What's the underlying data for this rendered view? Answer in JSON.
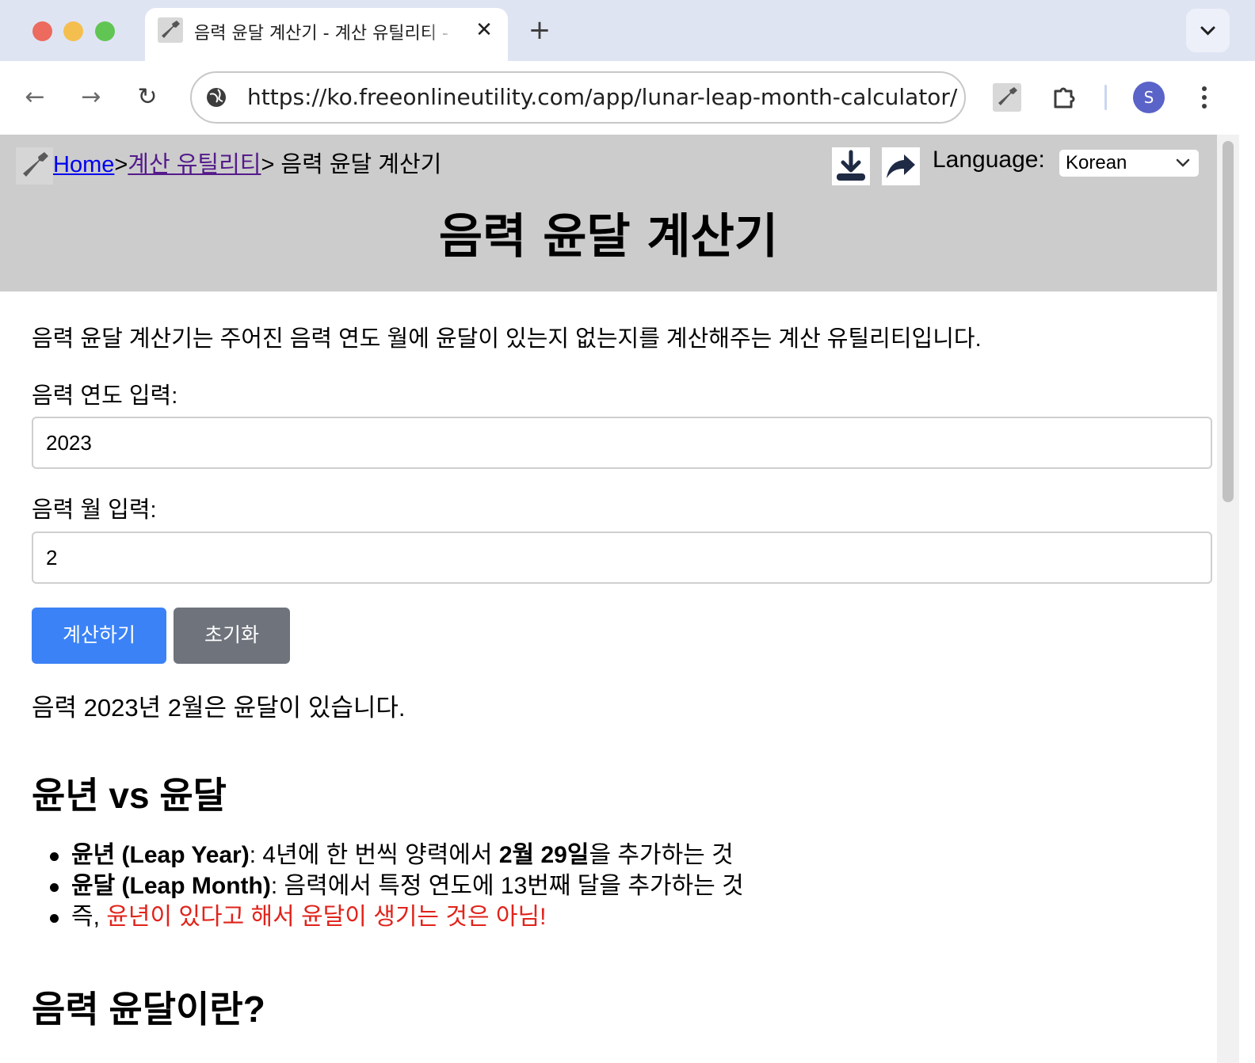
{
  "browser": {
    "tab_title": "음력 윤달 계산기 - 계산 유틸리티 - FreeOnlineUtility",
    "tab_close": "✕",
    "new_tab": "+",
    "url": "https://ko.freeonlineutility.com/app/lunar-leap-month-calculator/",
    "back": "←",
    "forward": "→",
    "reload": "↻",
    "profile_initial": "S"
  },
  "header": {
    "breadcrumb": {
      "home": "Home",
      "sep1": ">",
      "category": "계산 유틸리티",
      "sep2": ">",
      "current": " 음력 윤달 계산기"
    },
    "language_label": "Language:",
    "language_selected": "Korean",
    "title": "음력 윤달 계산기"
  },
  "main": {
    "intro": "음력 윤달 계산기는 주어진 음력 연도 월에 윤달이 있는지 없는지를 계산해주는 계산 유틸리티입니다.",
    "year_label": "음력 연도 입력:",
    "year_value": "2023",
    "month_label": "음력 월 입력:",
    "month_value": "2",
    "calc_button": "계산하기",
    "reset_button": "초기화",
    "result": "음력 2023년 2월은 윤달이 있습니다.",
    "section1_title": "윤년 vs 윤달",
    "bullets": [
      {
        "bold": "윤년 (Leap Year)",
        "text1": ": 4년에 한 번씩 양력에서 ",
        "bold2": "2월 29일",
        "text2": "을 추가하는 것"
      },
      {
        "bold": "윤달 (Leap Month)",
        "text1": ": 음력에서 특정 연도에 13번째 달을 추가하는 것"
      },
      {
        "text1": "즉, ",
        "red": "윤년이 있다고 해서 윤달이 생기는 것은 아님!"
      }
    ],
    "section2_title": "음력 윤달이란?"
  },
  "colors": {
    "primary_button": "#3b82f6",
    "secondary_button": "#6e737c",
    "header_bg": "#cccccc",
    "warning_text": "#e0231a",
    "link": "#0000ee",
    "visited_link": "#551a8b"
  },
  "icons": {
    "site_favicon": "wrench-icon",
    "download": "download-icon",
    "share": "share-arrow-icon",
    "extensions": "puzzle-icon",
    "site_info": "globe-icon",
    "menu": "kebab-menu-icon"
  }
}
